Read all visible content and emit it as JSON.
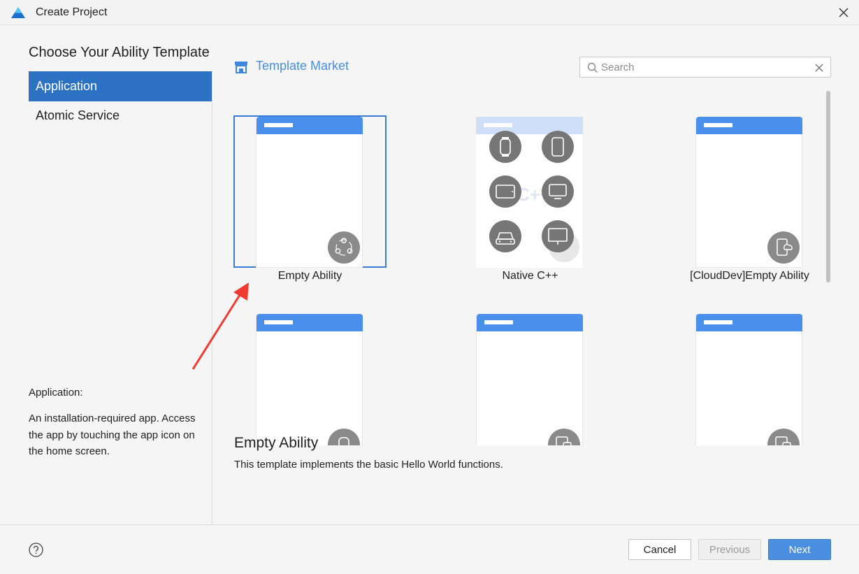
{
  "window": {
    "title": "Create Project"
  },
  "page": {
    "heading": "Choose Your Ability Template"
  },
  "sidebar": {
    "items": [
      {
        "label": "Application",
        "selected": true
      },
      {
        "label": "Atomic Service",
        "selected": false
      }
    ],
    "description_title": "Application:",
    "description": "An installation-required app. Access the app by touching the app icon on the home screen."
  },
  "market": {
    "label": "Template Market",
    "icon": "shop-icon"
  },
  "search": {
    "placeholder": "Search",
    "value": ""
  },
  "templates": [
    {
      "label": "Empty Ability",
      "selected": true,
      "badge_icon": "ability-icon"
    },
    {
      "label": "Native C++",
      "selected": false,
      "badge_icon": "cpp-icon"
    },
    {
      "label": "[CloudDev]Empty Ability",
      "selected": false,
      "badge_icon": "cloud-phone-icon"
    },
    {
      "label": "",
      "selected": false,
      "badge_icon": "watch-icon"
    },
    {
      "label": "",
      "selected": false,
      "badge_icon": "tablet-phone-icon"
    },
    {
      "label": "",
      "selected": false,
      "badge_icon": "tablet-phone-icon"
    }
  ],
  "detail": {
    "title": "Empty Ability",
    "description": "This template implements the basic Hello World functions."
  },
  "footer": {
    "cancel_label": "Cancel",
    "previous_label": "Previous",
    "next_label": "Next"
  },
  "colors": {
    "accent": "#2d72c2",
    "button_primary": "#4a8fe0",
    "template_bar": "#4a8fec"
  }
}
